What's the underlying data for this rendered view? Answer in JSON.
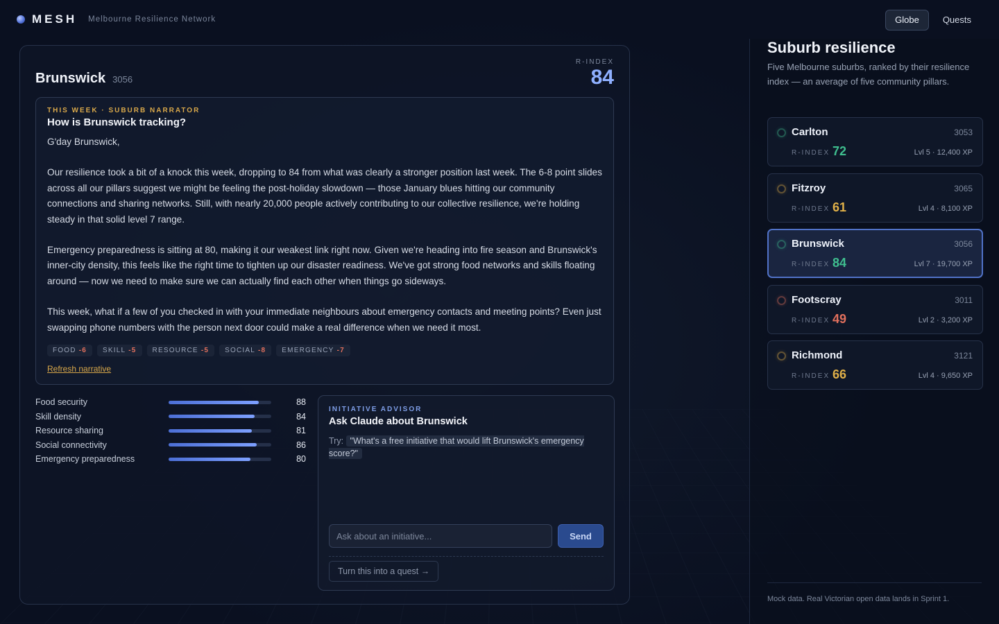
{
  "app": {
    "name": "MESH",
    "subtitle": "Melbourne Resilience Network"
  },
  "nav": {
    "items": [
      {
        "label": "Globe",
        "active": true
      },
      {
        "label": "Quests",
        "active": false
      }
    ]
  },
  "main": {
    "suburb": "Brunswick",
    "postcode": "3056",
    "rindex_label": "R-INDEX",
    "rindex_value": "84",
    "narrator": {
      "eyebrow": "THIS WEEK · SUBURB NARRATOR",
      "heading": "How is Brunswick tracking?",
      "greeting": "G'day Brunswick,",
      "paragraphs": [
        "Our resilience took a bit of a knock this week, dropping to 84 from what was clearly a stronger position last week. The 6-8 point slides across all our pillars suggest we might be feeling the post-holiday slowdown — those January blues hitting our community connections and sharing networks. Still, with nearly 20,000 people actively contributing to our collective resilience, we're holding steady in that solid level 7 range.",
        "Emergency preparedness is sitting at 80, making it our weakest link right now. Given we're heading into fire season and Brunswick's inner-city density, this feels like the right time to tighten up our disaster readiness. We've got strong food networks and skills floating around — now we need to make sure we can actually find each other when things go sideways.",
        "This week, what if a few of you checked in with your immediate neighbours about emergency contacts and meeting points? Even just swapping phone numbers with the person next door could make a real difference when we need it most."
      ],
      "deltas": [
        {
          "label": "FOOD",
          "value": "-6"
        },
        {
          "label": "SKILL",
          "value": "-5"
        },
        {
          "label": "RESOURCE",
          "value": "-5"
        },
        {
          "label": "SOCIAL",
          "value": "-8"
        },
        {
          "label": "EMERGENCY",
          "value": "-7"
        }
      ],
      "refresh_label": "Refresh narrative"
    },
    "pillars": [
      {
        "name": "Food security",
        "value": 88,
        "fill": 0.88
      },
      {
        "name": "Skill density",
        "value": 84,
        "fill": 0.84
      },
      {
        "name": "Resource sharing",
        "value": 81,
        "fill": 0.81
      },
      {
        "name": "Social connectivity",
        "value": 86,
        "fill": 0.86
      },
      {
        "name": "Emergency preparedness",
        "value": 80,
        "fill": 0.8
      }
    ],
    "advisor": {
      "eyebrow": "INITIATIVE ADVISOR",
      "heading": "Ask Claude about Brunswick",
      "try_label": "Try:",
      "try_prompt": "\"What's a free initiative that would lift Brunswick's emergency score?\"",
      "input_placeholder": "Ask about an initiative...",
      "send_label": "Send",
      "quest_label": "Turn this into a quest →"
    }
  },
  "sidebar": {
    "title": "Suburb resilience",
    "description": "Five Melbourne suburbs, ranked by their resilience index — an average of five community pillars.",
    "rindex_label": "R-INDEX",
    "suburbs": [
      {
        "name": "Carlton",
        "postcode": "3053",
        "rindex": "72",
        "level": "Lvl 5 · 12,400 XP",
        "color": "#3fbf8f",
        "selected": false
      },
      {
        "name": "Fitzroy",
        "postcode": "3065",
        "rindex": "61",
        "level": "Lvl 4 · 8,100 XP",
        "color": "#e0b048",
        "selected": false
      },
      {
        "name": "Brunswick",
        "postcode": "3056",
        "rindex": "84",
        "level": "Lvl 7 · 19,700 XP",
        "color": "#3fbf8f",
        "selected": true
      },
      {
        "name": "Footscray",
        "postcode": "3011",
        "rindex": "49",
        "level": "Lvl 2 · 3,200 XP",
        "color": "#e2705d",
        "selected": false
      },
      {
        "name": "Richmond",
        "postcode": "3121",
        "rindex": "66",
        "level": "Lvl 4 · 9,650 XP",
        "color": "#e0b048",
        "selected": false
      }
    ],
    "footer": "Mock data. Real Victorian open data lands in Sprint 1."
  }
}
